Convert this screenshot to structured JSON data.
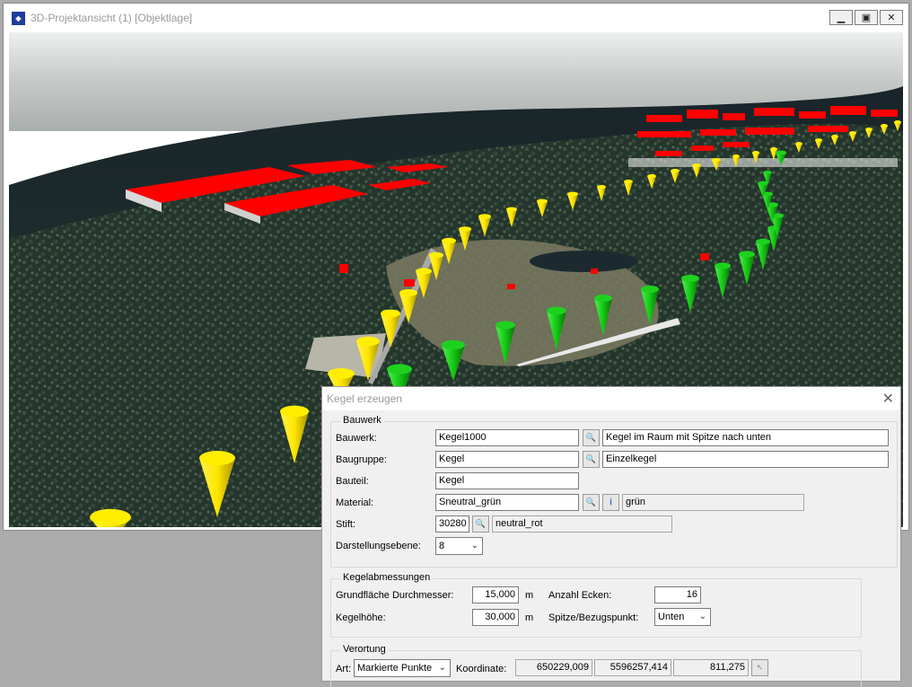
{
  "window": {
    "title": "3D-Projektansicht (1) [Objektlage]",
    "minimize_glyph": "▁",
    "maximize_glyph": "▣",
    "close_glyph": "✕",
    "icon": "app-logo-icon"
  },
  "dialog": {
    "title": "Kegel erzeugen",
    "close_glyph": "✕",
    "bauwerk_group": {
      "label": "Bauwerk",
      "bauwerk_label": "Bauwerk:",
      "bauwerk_value": "Kegel1000",
      "bauwerk_desc": "Kegel im Raum mit Spitze nach unten",
      "baugruppe_label": "Baugruppe:",
      "baugruppe_value": "Kegel",
      "baugruppe_desc": "Einzelkegel",
      "bauteil_label": "Bauteil:",
      "bauteil_value": "Kegel",
      "material_label": "Material:",
      "material_value": "Sneutral_grün",
      "material_desc": "grün",
      "stift_label": "Stift:",
      "stift_value": "30280",
      "stift_desc": "neutral_rot",
      "ebene_label": "Darstellungsebene:",
      "ebene_value": "8"
    },
    "abmessungen_group": {
      "label": "Kegelabmessungen",
      "durchmesser_label": "Grundfläche Durchmesser:",
      "durchmesser_value": "15,000",
      "durchmesser_unit": "m",
      "hoehe_label": "Kegelhöhe:",
      "hoehe_value": "30,000",
      "hoehe_unit": "m",
      "ecken_label": "Anzahl Ecken:",
      "ecken_value": "16",
      "spitze_label": "Spitze/Bezugspunkt:",
      "spitze_value": "Unten"
    },
    "verortung_group": {
      "label": "Verortung",
      "art_label": "Art:",
      "art_value": "Markierte Punkte",
      "koord_label": "Koordinate:",
      "x": "650229,009",
      "y": "5596257,414",
      "z": "811,275"
    }
  },
  "colors": {
    "building_roof": "#ff0000",
    "cone_yellow": "#ffee00",
    "cone_green": "#1fd11f"
  }
}
